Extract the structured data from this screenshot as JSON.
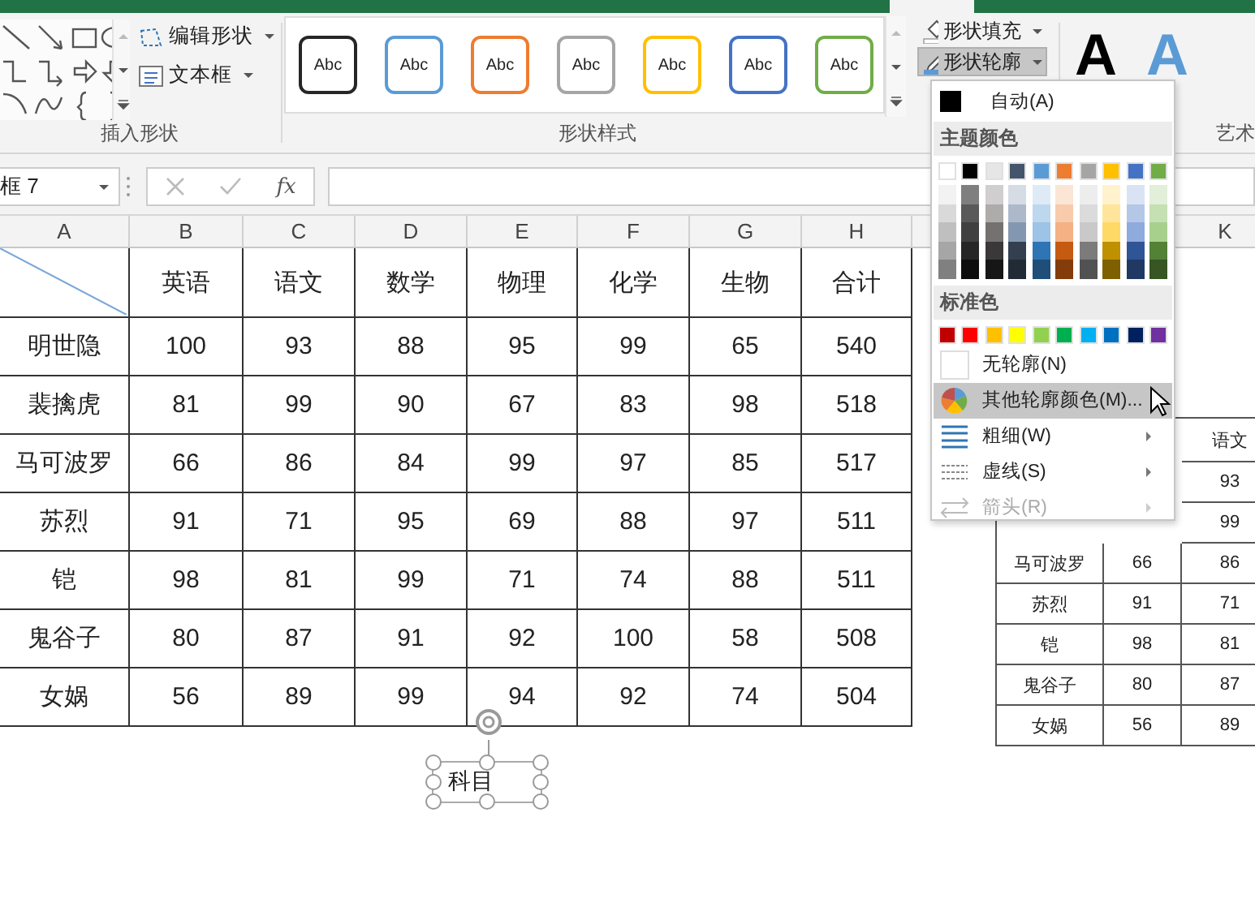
{
  "ribbon": {
    "insert_shapes": {
      "label": "插入形状",
      "edit_shape": "编辑形状",
      "text_box": "文本框"
    },
    "shape_styles": {
      "label": "形状样式",
      "swatches": [
        {
          "text": "Abc",
          "color": "#262626"
        },
        {
          "text": "Abc",
          "color": "#5b9bd5"
        },
        {
          "text": "Abc",
          "color": "#ed7d31"
        },
        {
          "text": "Abc",
          "color": "#a5a5a5"
        },
        {
          "text": "Abc",
          "color": "#ffc000"
        },
        {
          "text": "Abc",
          "color": "#4472c4"
        },
        {
          "text": "Abc",
          "color": "#70ad47"
        }
      ]
    },
    "shape_fill": {
      "label": "形状填充",
      "selected": false
    },
    "shape_outline": {
      "label": "形状轮廓",
      "selected": true
    },
    "art_text": {
      "label": "艺术",
      "letters": [
        {
          "text": "A",
          "color": "#000000"
        },
        {
          "text": "A",
          "color": "#5b9bd5"
        }
      ]
    }
  },
  "formula_bar": {
    "name_box": "框 7",
    "fx": "fx"
  },
  "sheet": {
    "columns": [
      "A",
      "B",
      "C",
      "D",
      "E",
      "F",
      "G",
      "H",
      "K"
    ],
    "header": [
      "英语",
      "语文",
      "数学",
      "物理",
      "化学",
      "生物",
      "合计"
    ],
    "rows": [
      {
        "name": "明世隐",
        "values": [
          "100",
          "93",
          "88",
          "95",
          "99",
          "65",
          "540"
        ]
      },
      {
        "name": "裴擒虎",
        "values": [
          "81",
          "99",
          "90",
          "67",
          "83",
          "98",
          "518"
        ]
      },
      {
        "name": "马可波罗",
        "values": [
          "66",
          "86",
          "84",
          "99",
          "97",
          "85",
          "517"
        ]
      },
      {
        "name": "苏烈",
        "values": [
          "91",
          "71",
          "95",
          "69",
          "88",
          "97",
          "511"
        ]
      },
      {
        "name": "铠",
        "values": [
          "98",
          "81",
          "99",
          "71",
          "74",
          "88",
          "511"
        ]
      },
      {
        "name": "鬼谷子",
        "values": [
          "80",
          "87",
          "91",
          "92",
          "100",
          "58",
          "508"
        ]
      },
      {
        "name": "女娲",
        "values": [
          "56",
          "89",
          "99",
          "94",
          "92",
          "74",
          "504"
        ]
      }
    ]
  },
  "floating_table": {
    "rows": [
      [
        "语文"
      ],
      [
        "93"
      ],
      [
        "99"
      ],
      [
        "马可波罗",
        "66",
        "86"
      ],
      [
        "苏烈",
        "91",
        "71"
      ],
      [
        "铠",
        "98",
        "81"
      ],
      [
        "鬼谷子",
        "80",
        "87"
      ],
      [
        "女娲",
        "56",
        "89"
      ]
    ]
  },
  "text_box": {
    "text": "科目"
  },
  "outline_menu": {
    "auto": {
      "label": "自动(A)",
      "color": "#000000"
    },
    "theme_title": "主题颜色",
    "theme_colors": [
      {
        "color": "#ffffff",
        "shades": [
          {
            "color": "#f2f2f2"
          },
          {
            "color": "#d9d9d9"
          },
          {
            "color": "#bfbfbf"
          },
          {
            "color": "#a6a6a6"
          },
          {
            "color": "#808080"
          }
        ]
      },
      {
        "color": "#000000",
        "shades": [
          {
            "color": "#7f7f7f"
          },
          {
            "color": "#595959"
          },
          {
            "color": "#404040"
          },
          {
            "color": "#262626"
          },
          {
            "color": "#0d0d0d"
          }
        ]
      },
      {
        "color": "#e7e6e6",
        "shades": [
          {
            "color": "#d0cece"
          },
          {
            "color": "#aeabab"
          },
          {
            "color": "#757171"
          },
          {
            "color": "#3a3838"
          },
          {
            "color": "#171616"
          }
        ]
      },
      {
        "color": "#44546a",
        "shades": [
          {
            "color": "#d6dce4"
          },
          {
            "color": "#adb9ca"
          },
          {
            "color": "#8497b0"
          },
          {
            "color": "#333f4f"
          },
          {
            "color": "#222a35"
          }
        ]
      },
      {
        "color": "#5b9bd5",
        "shades": [
          {
            "color": "#deebf6"
          },
          {
            "color": "#bdd7ee"
          },
          {
            "color": "#9dc3e6"
          },
          {
            "color": "#2e75b5"
          },
          {
            "color": "#1f4e79"
          }
        ]
      },
      {
        "color": "#ed7d31",
        "shades": [
          {
            "color": "#fbe5d5"
          },
          {
            "color": "#f7cbac"
          },
          {
            "color": "#f4b183"
          },
          {
            "color": "#c55a11"
          },
          {
            "color": "#843c0b"
          }
        ]
      },
      {
        "color": "#a5a5a5",
        "shades": [
          {
            "color": "#ededed"
          },
          {
            "color": "#dbdbdb"
          },
          {
            "color": "#c9c9c9"
          },
          {
            "color": "#7b7b7b"
          },
          {
            "color": "#525252"
          }
        ]
      },
      {
        "color": "#ffc000",
        "shades": [
          {
            "color": "#fff2cc"
          },
          {
            "color": "#fee599"
          },
          {
            "color": "#ffd965"
          },
          {
            "color": "#bf9000"
          },
          {
            "color": "#7f6000"
          }
        ]
      },
      {
        "color": "#4472c4",
        "shades": [
          {
            "color": "#dae3f3"
          },
          {
            "color": "#b4c7e7"
          },
          {
            "color": "#8faadc"
          },
          {
            "color": "#2f5597"
          },
          {
            "color": "#203864"
          }
        ]
      },
      {
        "color": "#70ad47",
        "shades": [
          {
            "color": "#e2efd9"
          },
          {
            "color": "#c5e0b3"
          },
          {
            "color": "#a8d08d"
          },
          {
            "color": "#538135"
          },
          {
            "color": "#375623"
          }
        ]
      }
    ],
    "standard_title": "标准色",
    "standard_colors": [
      {
        "color": "#c00000"
      },
      {
        "color": "#ff0000"
      },
      {
        "color": "#ffc000"
      },
      {
        "color": "#ffff00"
      },
      {
        "color": "#92d050"
      },
      {
        "color": "#00b050"
      },
      {
        "color": "#00b0f0"
      },
      {
        "color": "#0070c0"
      },
      {
        "color": "#002060"
      },
      {
        "color": "#7030a0"
      }
    ],
    "items": [
      {
        "kind": "none",
        "label": "无轮廓(N)",
        "highlighted": false,
        "disabled": false,
        "submenu": false
      },
      {
        "kind": "more",
        "label": "其他轮廓颜色(M)...",
        "highlighted": true,
        "disabled": false,
        "submenu": false
      },
      {
        "kind": "weight",
        "label": "粗细(W)",
        "highlighted": false,
        "disabled": false,
        "submenu": true
      },
      {
        "kind": "dash",
        "label": "虚线(S)",
        "highlighted": false,
        "disabled": false,
        "submenu": true
      },
      {
        "kind": "arrow",
        "label": "箭头(R)",
        "highlighted": false,
        "disabled": true,
        "submenu": true
      }
    ]
  }
}
